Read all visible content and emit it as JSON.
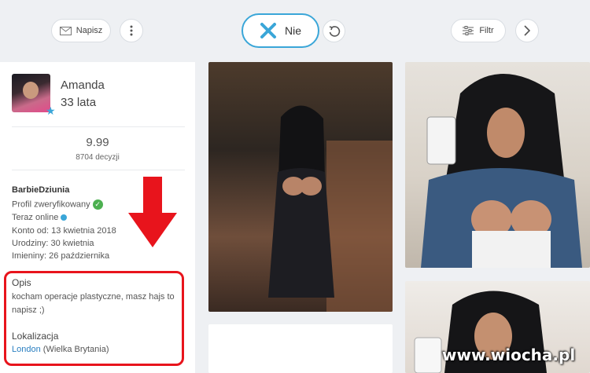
{
  "toolbar": {
    "message_label": "Napisz",
    "reject_label": "Nie",
    "filter_label": "Filtr",
    "accent_color": "#3aa6d8"
  },
  "profile": {
    "name": "Amanda",
    "age": "33 lata",
    "rating": "9.99",
    "decisions": "8704 decyzji",
    "username": "BarbieDziunia",
    "verified": "Profil zweryfikowany",
    "online": "Teraz online",
    "member_since": "Konto od: 13 kwietnia 2018",
    "birthday": "Urodziny: 30 kwietnia",
    "name_day": "Imieniny: 26 października",
    "about_title": "Opis",
    "about_text": "kocham operacje plastyczne, masz hajs to napisz ;)",
    "location_title": "Lokalizacja",
    "location_city": "London",
    "location_country": "(Wielka Brytania)"
  },
  "watermark": "www.wiocha.pl"
}
